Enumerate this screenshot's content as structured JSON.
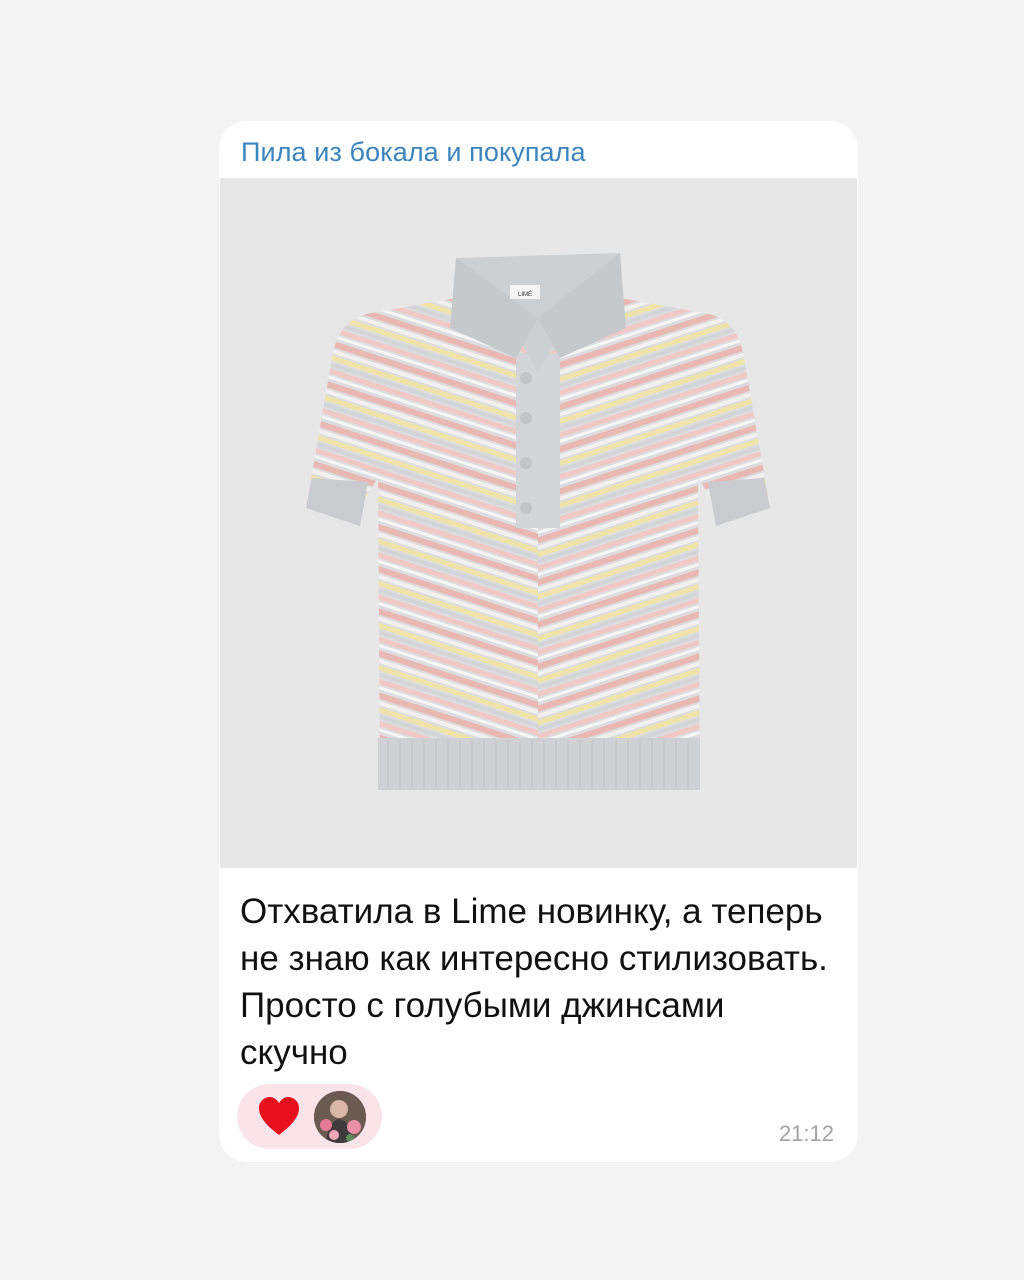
{
  "message": {
    "sender_name": "Пила из бокала и покупала",
    "text": "Отхватила в Lime новинку, а теперь не знаю как интересно стилизовать. Просто с голубыми джинсами скучно",
    "time": "21:12",
    "photo": {
      "brand_tag": "LIMÉ"
    },
    "reactions": [
      {
        "icon": "heart-icon",
        "color": "#e8101c"
      },
      {
        "icon": "avatar",
        "type": "reactor-avatar"
      }
    ]
  },
  "colors": {
    "page_background": "#f3f3f3",
    "bubble_background": "#ffffff",
    "sender_name": "#3a85bd",
    "reaction_pill": "#fbe3ea",
    "time_text": "#a3a3a3"
  }
}
